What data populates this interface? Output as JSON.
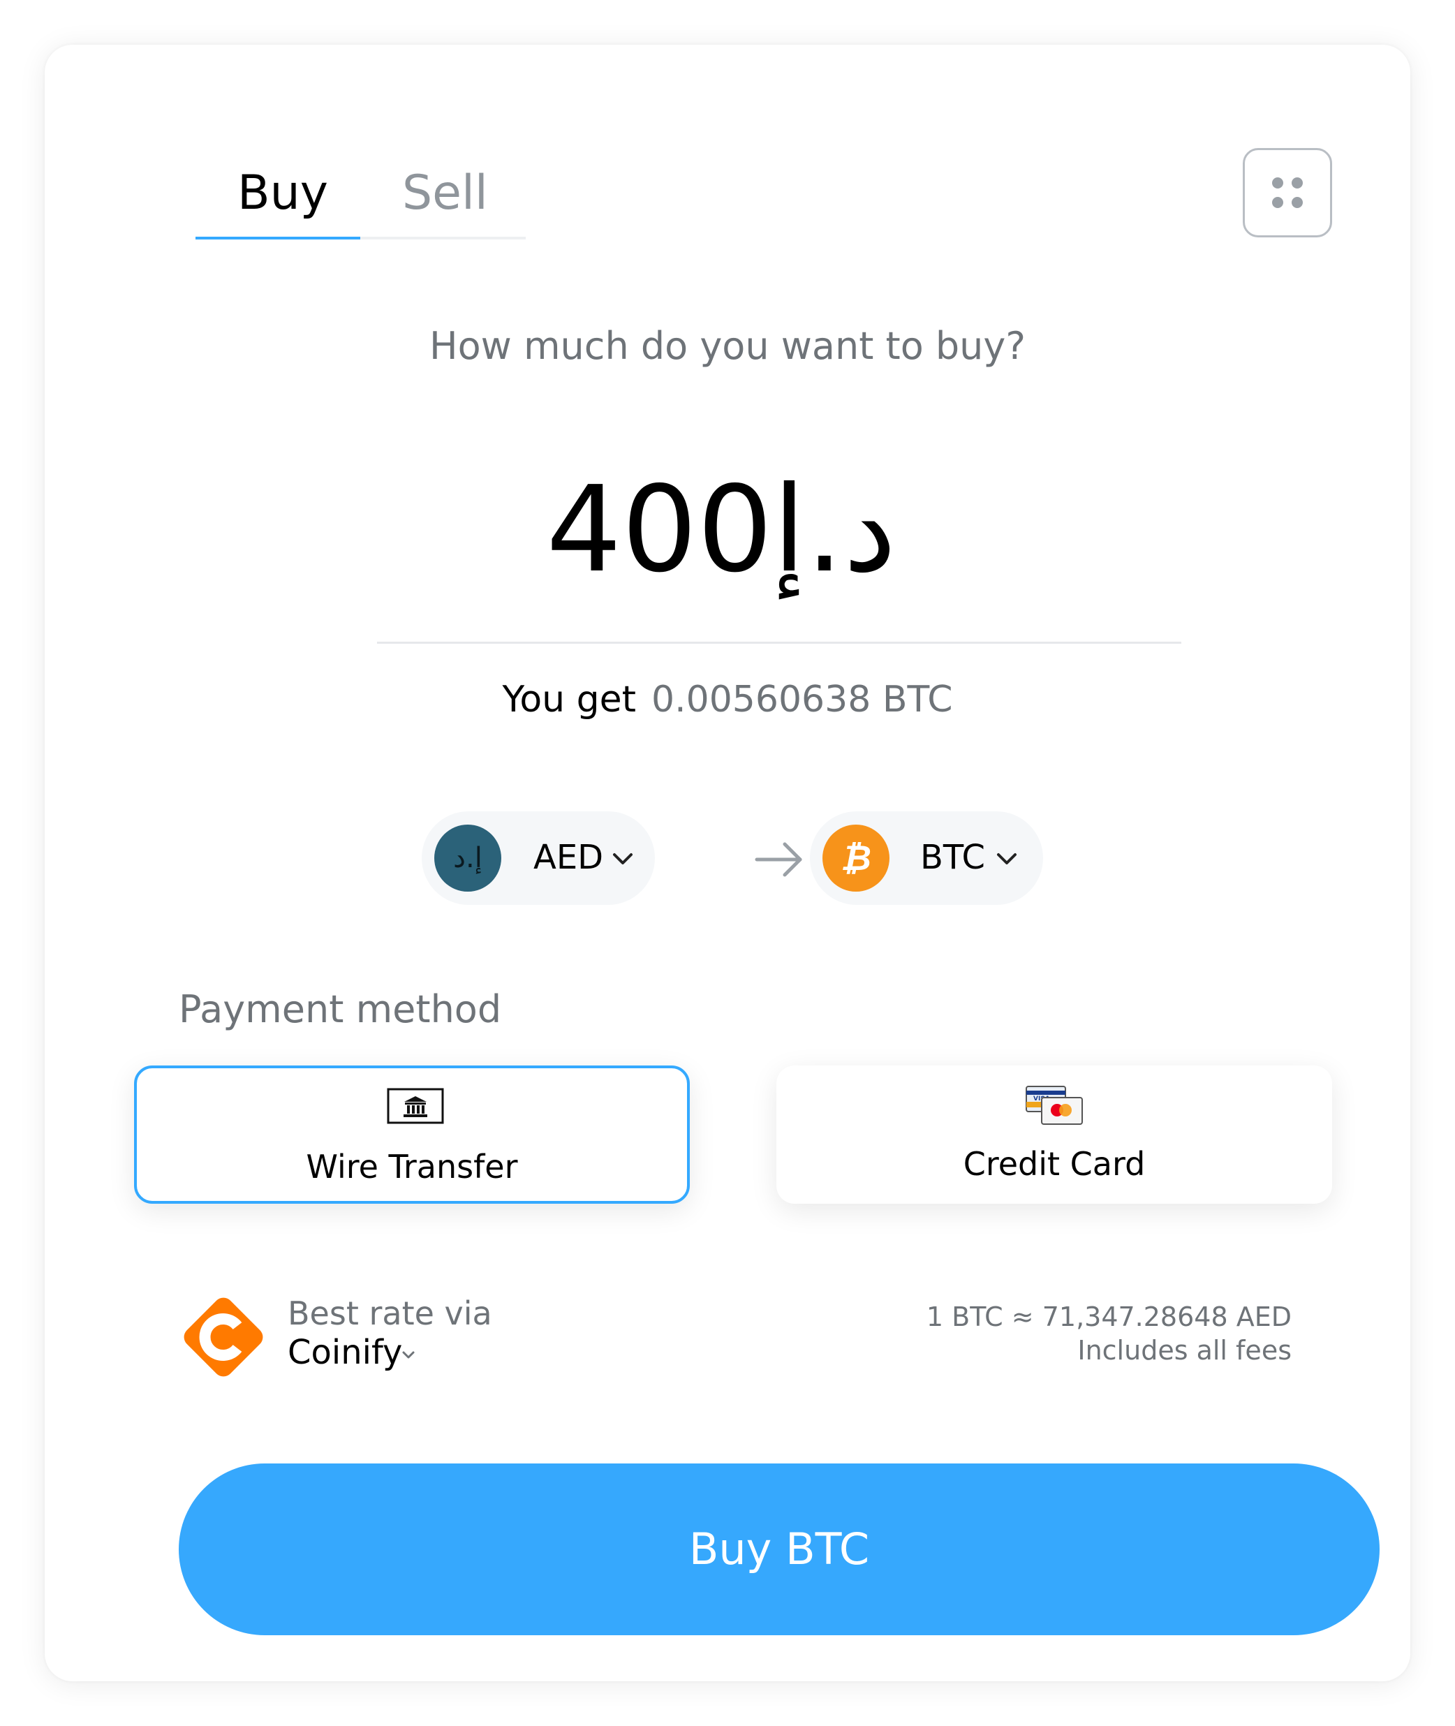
{
  "tabs": {
    "buy": "Buy",
    "sell": "Sell",
    "active": "Buy"
  },
  "menu": {
    "icon": "grid-dots-icon"
  },
  "amount_prompt": "How much do you want to buy?",
  "amount": {
    "currency_symbol": "د.إ",
    "value": "400"
  },
  "receive": {
    "label": "You get",
    "value": "0.00560638 BTC"
  },
  "from_currency": {
    "code": "AED",
    "symbol": "إ.د",
    "color": "#2b6279",
    "icon": "chevron-down-icon"
  },
  "to_currency": {
    "code": "BTC",
    "symbol": "₿",
    "color": "#f7931a",
    "icon": "chevron-down-icon"
  },
  "conversion_icon": "arrow-right-icon",
  "payment": {
    "label": "Payment method",
    "methods": [
      {
        "name": "Wire Transfer",
        "icon": "bank-icon",
        "selected": true
      },
      {
        "name": "Credit Card",
        "icon": "credit-card-icon",
        "selected": false
      }
    ]
  },
  "provider": {
    "prefix": "Best rate via",
    "name": "Coinify",
    "logo": "coinify-logo",
    "color": "#ff7a00",
    "rate": "1 BTC ≈ 71,347.28648 AED",
    "fees": "Includes all fees"
  },
  "cta": {
    "label": "Buy BTC",
    "color": "#36a8fd"
  }
}
